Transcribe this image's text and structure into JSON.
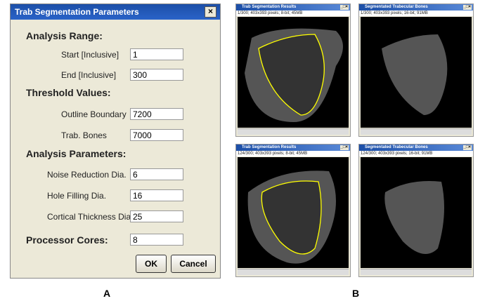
{
  "dialog": {
    "title": "Trab Segmentation Parameters",
    "close": "×",
    "sections": {
      "range": "Analysis Range:",
      "threshold": "Threshold Values:",
      "params": "Analysis Parameters:",
      "cores": "Processor Cores:"
    },
    "fields": [
      {
        "label": "Start  [Inclusive]",
        "value": "1"
      },
      {
        "label": "End  [Inclusive]",
        "value": "300"
      },
      {
        "label": "Outline Boundary",
        "value": "7200"
      },
      {
        "label": "Trab. Bones",
        "value": "7000"
      },
      {
        "label": "Noise Reduction Dia.",
        "value": "6"
      },
      {
        "label": "Hole Filling Dia.",
        "value": "16"
      },
      {
        "label": "Cortical Thickness Dia.",
        "value": "25"
      }
    ],
    "cores_value": "8",
    "ok": "OK",
    "cancel": "Cancel"
  },
  "windows": [
    {
      "title": "Trab Segmentation Results",
      "status": "1/300; 403x393 pixels; 8-bit; 45MB"
    },
    {
      "title": "Segmentated Trabecular Bones",
      "status": "1/300; 403x393 pixels; 16-bit; 91MB"
    },
    {
      "title": "Trab Segmentation Results",
      "status": "124/300; 403x393 pixels; 8-bit; 45MB"
    },
    {
      "title": "Segmentated Trabecular Bones",
      "status": "124/300; 403x393 pixels; 16-bit; 91MB"
    }
  ],
  "window_buttons": "_□×",
  "captions": {
    "a": "A",
    "b": "B"
  },
  "colors": {
    "title": "#1c4fa8",
    "outline": "#ffff00"
  }
}
